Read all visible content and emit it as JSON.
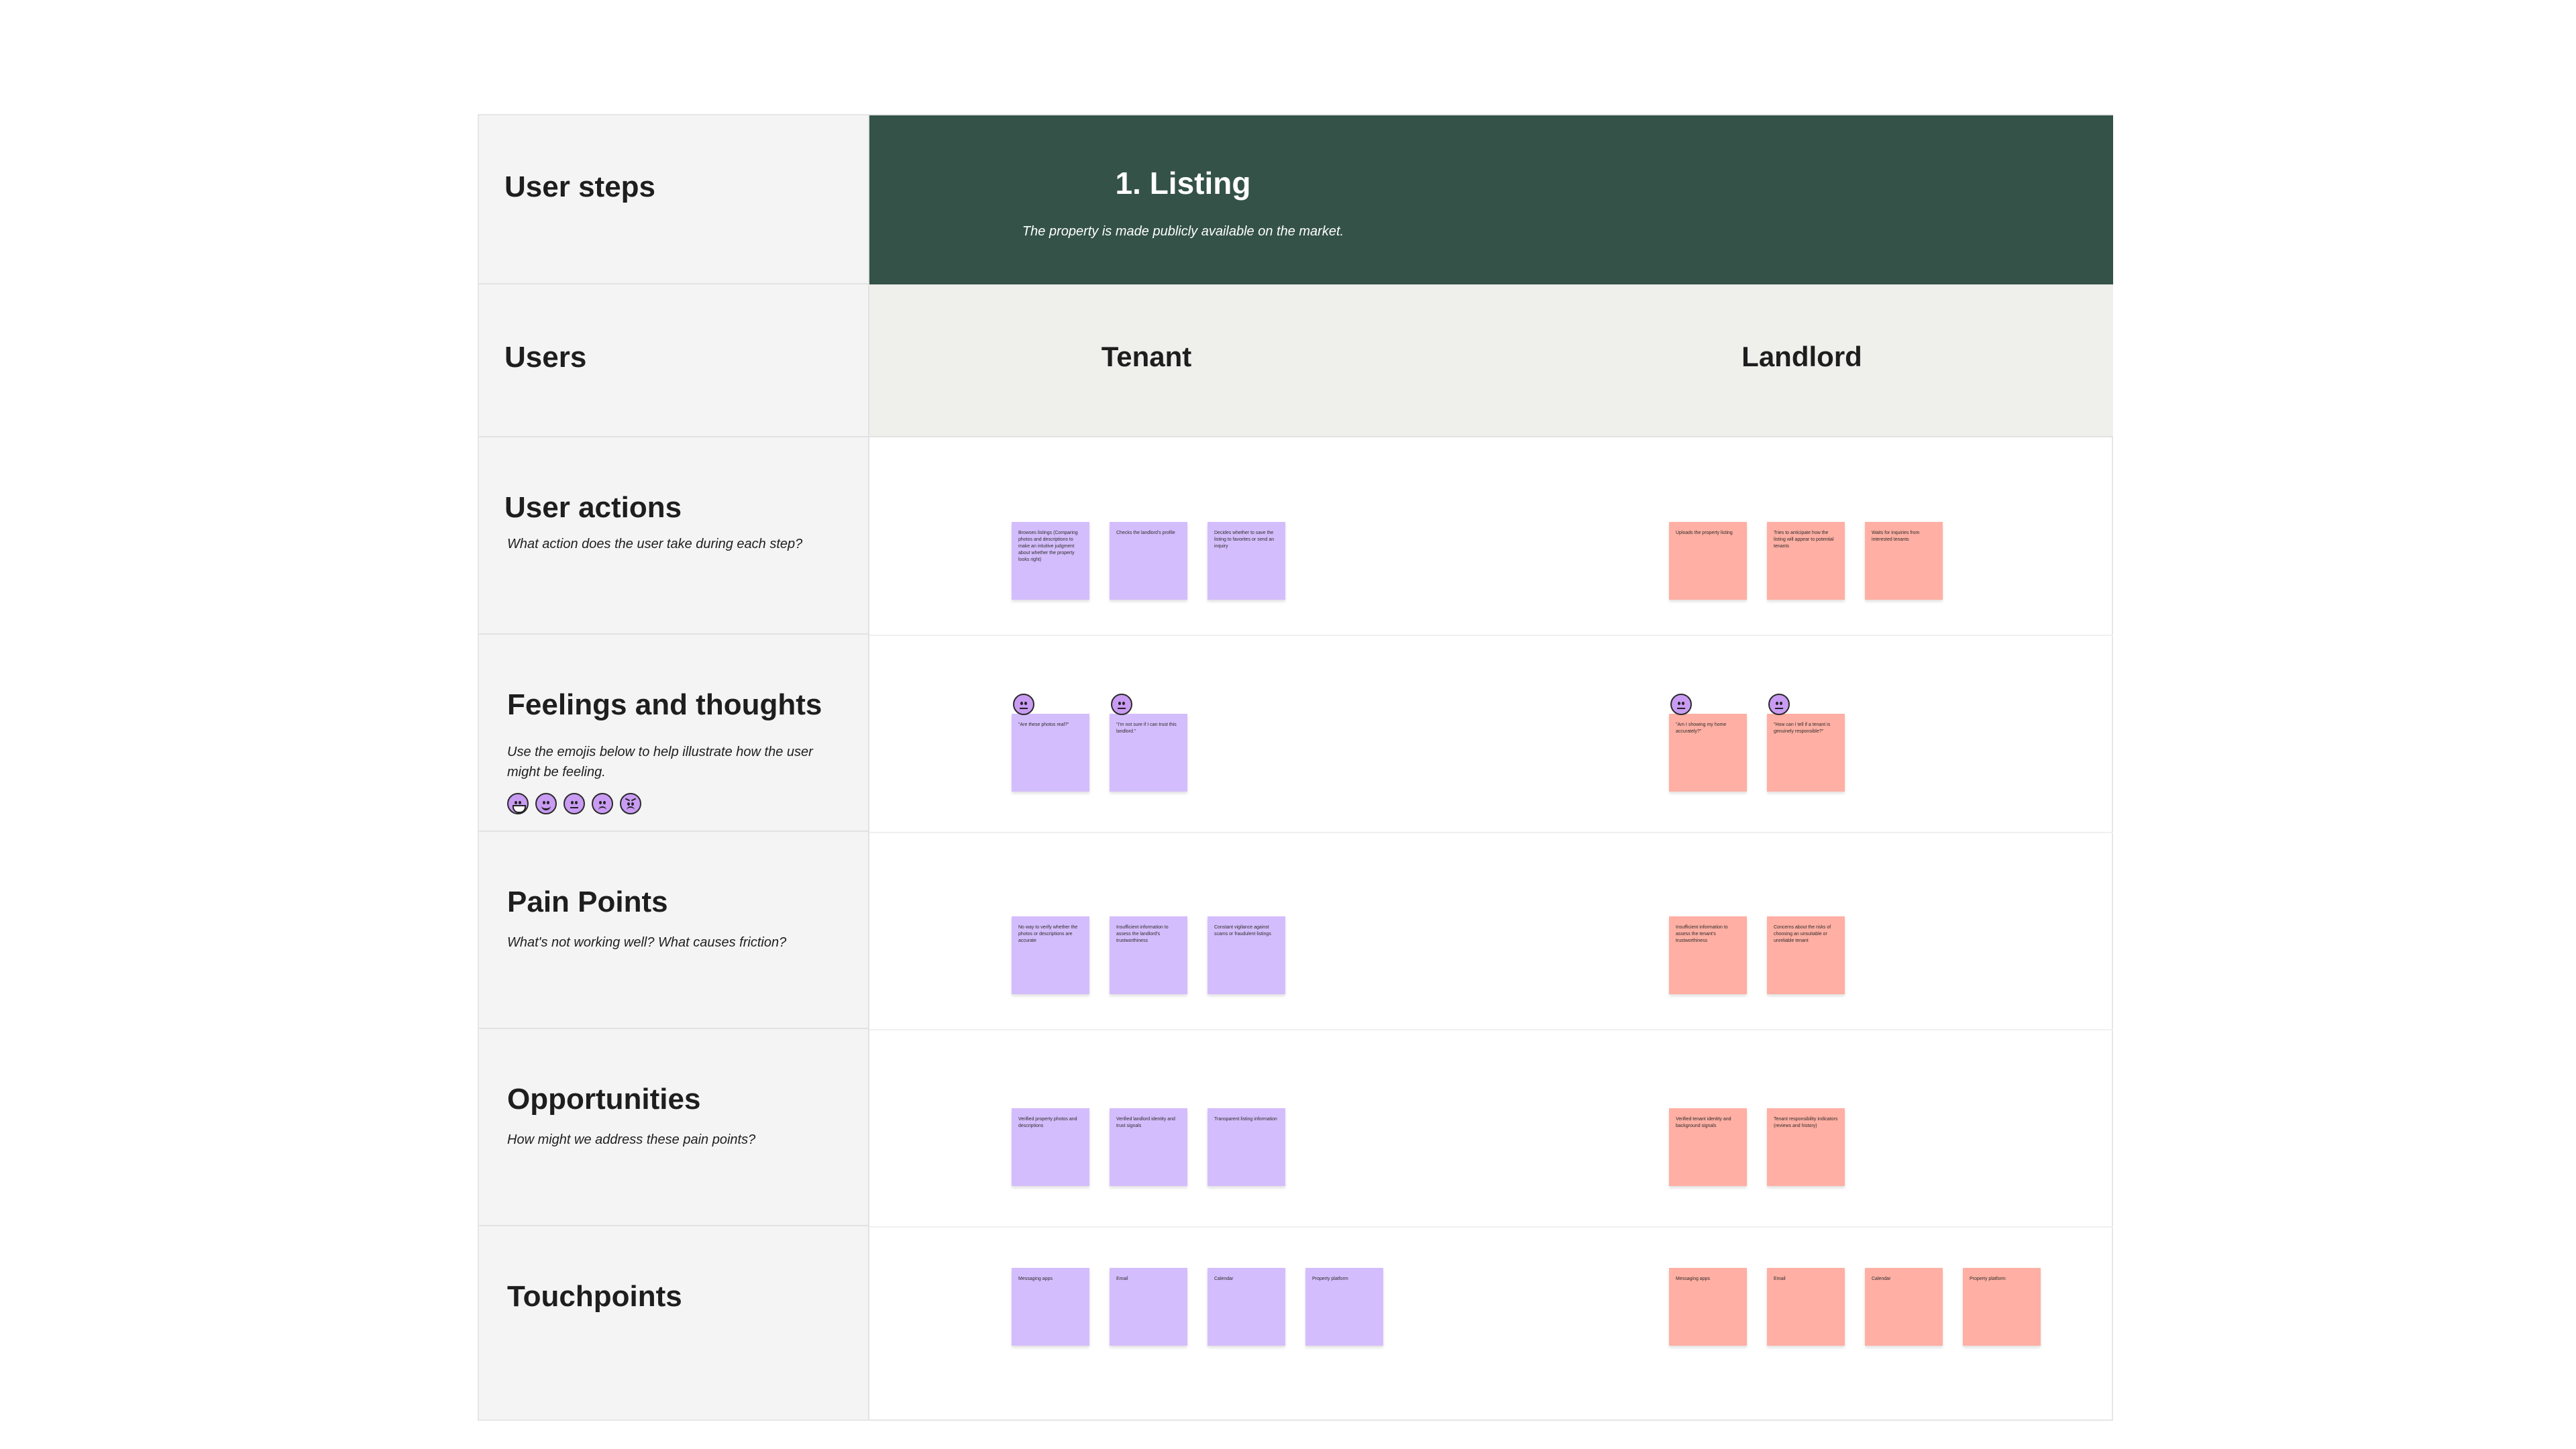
{
  "rows": {
    "user_steps": {
      "title": "User steps"
    },
    "users": {
      "title": "Users"
    },
    "user_actions": {
      "title": "User actions",
      "hint": "What action does the user take during each step?"
    },
    "feelings": {
      "title": "Feelings and thoughts",
      "hint": "Use the emojis below to help illustrate how the user might be feeling."
    },
    "pain_points": {
      "title": "Pain Points",
      "hint": "What's not working well? What causes friction?"
    },
    "opportunities": {
      "title": "Opportunities",
      "hint": "How might we address these pain points?"
    },
    "touchpoints": {
      "title": "Touchpoints"
    }
  },
  "step": {
    "title": "1. Listing",
    "description": "The property is made publicly available on the market."
  },
  "users": {
    "tenant": "Tenant",
    "landlord": "Landlord"
  },
  "colors": {
    "header": "#345247",
    "tenant_sticky": "#d4bdfc",
    "landlord_sticky": "#ffafa3",
    "emoji": "#c99bf2"
  },
  "stickies": {
    "tenant_actions": [
      "Browses listings (Comparing photos and descriptions to make an intuitive judgment about whether the property looks right)",
      "Checks the landlord's profile",
      "Decides whether to save the listing to favorites or send an inquiry"
    ],
    "landlord_actions": [
      "Uploads the property listing",
      "Tries to anticipate how the listing will appear to potential tenants",
      "Waits for inquiries from interested tenants"
    ],
    "tenant_feelings": [
      "\"Are these photos real?\"",
      "\"I'm not sure if I can trust this landlord.\""
    ],
    "landlord_feelings": [
      "\"Am I showing my home accurately?\"",
      "\"How can I tell if a tenant is genuinely responsible?\""
    ],
    "tenant_pains": [
      "No way to verify whether the photos or descriptions are accurate",
      "Insufficient information to assess the landlord's trustworthiness",
      "Constant vigilance against scams or fraudulent listings"
    ],
    "landlord_pains": [
      "Insufficient information to assess the tenant's trustworthiness",
      "Concerns about the risks of choosing an unsuitable or unreliable tenant"
    ],
    "tenant_opps": [
      "Verified property photos and descriptions",
      "Verified landlord identity and trust signals",
      "Transparent listing information"
    ],
    "landlord_opps": [
      "Verified tenant identity and background signals",
      "Tenant responsibility indicators (reviews and history)"
    ],
    "tenant_touch": [
      "Messaging apps",
      "Email",
      "Calendar",
      "Property platform"
    ],
    "landlord_touch": [
      "Messaging apps",
      "Email",
      "Calendar",
      "Property platform"
    ]
  },
  "emoji_legend": [
    "very-happy-emoji",
    "happy-emoji",
    "neutral-emoji",
    "sad-emoji",
    "angry-emoji"
  ]
}
